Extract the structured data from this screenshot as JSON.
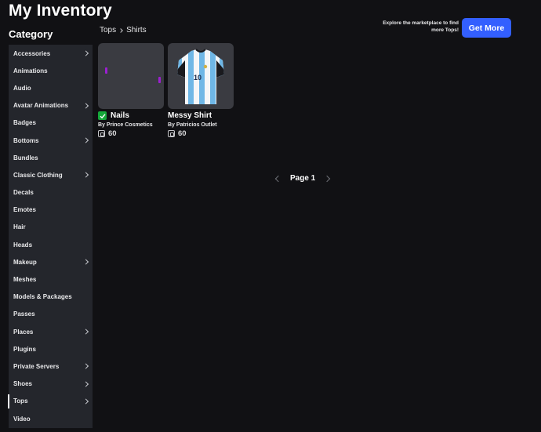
{
  "page": {
    "title": "My Inventory"
  },
  "sidebar": {
    "heading": "Category",
    "items": [
      {
        "label": "Accessories",
        "has_submenu": true
      },
      {
        "label": "Animations",
        "has_submenu": false
      },
      {
        "label": "Audio",
        "has_submenu": false
      },
      {
        "label": "Avatar Animations",
        "has_submenu": true
      },
      {
        "label": "Badges",
        "has_submenu": false
      },
      {
        "label": "Bottoms",
        "has_submenu": true
      },
      {
        "label": "Bundles",
        "has_submenu": false
      },
      {
        "label": "Classic Clothing",
        "has_submenu": true
      },
      {
        "label": "Decals",
        "has_submenu": false
      },
      {
        "label": "Emotes",
        "has_submenu": false
      },
      {
        "label": "Hair",
        "has_submenu": false
      },
      {
        "label": "Heads",
        "has_submenu": false
      },
      {
        "label": "Makeup",
        "has_submenu": true
      },
      {
        "label": "Meshes",
        "has_submenu": false
      },
      {
        "label": "Models & Packages",
        "has_submenu": false
      },
      {
        "label": "Passes",
        "has_submenu": false
      },
      {
        "label": "Places",
        "has_submenu": true
      },
      {
        "label": "Plugins",
        "has_submenu": false
      },
      {
        "label": "Private Servers",
        "has_submenu": true
      },
      {
        "label": "Shoes",
        "has_submenu": true
      },
      {
        "label": "Tops",
        "has_submenu": true,
        "active": true
      },
      {
        "label": "Video",
        "has_submenu": false
      }
    ]
  },
  "breadcrumb": {
    "parent": "Tops",
    "current": "Shirts"
  },
  "promo": {
    "text": "Explore the marketplace to find more Tops!",
    "button_label": "Get More"
  },
  "items": [
    {
      "name": "Nails",
      "by_prefix": "By",
      "creator": "Prince Cosmetics",
      "price": "60",
      "owned_check": true,
      "icon": "nails-thumbnail"
    },
    {
      "name": "Messy Shirt",
      "by_prefix": "By",
      "creator": "Patricios Outlet",
      "price": "60",
      "owned_check": false,
      "icon": "shirt-thumbnail"
    }
  ],
  "pagination": {
    "label": "Page 1"
  },
  "colors": {
    "accent": "#335fff",
    "background": "#111114",
    "sidebar": "#24262c",
    "check": "#15a83a"
  }
}
